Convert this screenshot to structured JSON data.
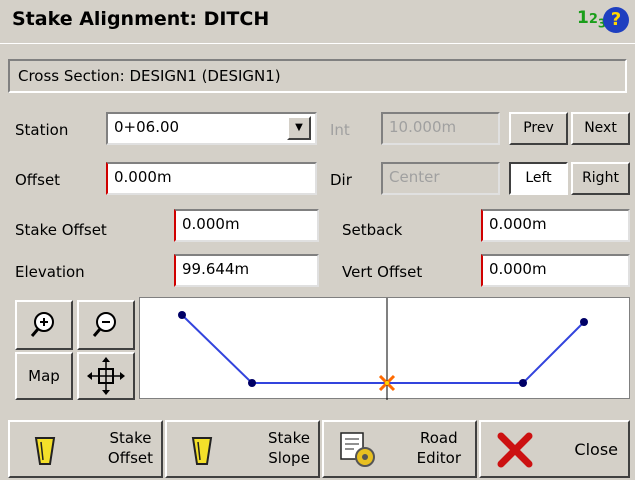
{
  "title": "Stake Alignment: DITCH",
  "mode_indicator": "123",
  "help_glyph": "?",
  "cross_section": "Cross Section: DESIGN1 (DESIGN1)",
  "station": {
    "label": "Station",
    "value": "0+06.00"
  },
  "interval": {
    "label": "Int",
    "value": "10.000m"
  },
  "prev_label": "Prev",
  "next_label": "Next",
  "offset": {
    "label": "Offset",
    "value": "0.000m"
  },
  "direction": {
    "label": "Dir",
    "value": "Center"
  },
  "left_label": "Left",
  "right_label": "Right",
  "stake_offset": {
    "label": "Stake Offset",
    "value": "0.000m"
  },
  "setback": {
    "label": "Setback",
    "value": "0.000m"
  },
  "elevation": {
    "label": "Elevation",
    "value": "99.644m"
  },
  "vert_offset": {
    "label": "Vert Offset",
    "value": "0.000m"
  },
  "map_label": "Map",
  "toolbar": {
    "stake_offset": [
      "Stake",
      "Offset"
    ],
    "stake_slope": [
      "Stake",
      "Slope"
    ],
    "road_editor": [
      "Road",
      "Editor"
    ],
    "close": "Close"
  },
  "colors": {
    "accent_blue": "#1e3fc0",
    "line_blue": "#3344dd",
    "marker_orange": "#ff6a00",
    "red_x": "#cc1111",
    "mode_green": "#1a9e1a"
  }
}
